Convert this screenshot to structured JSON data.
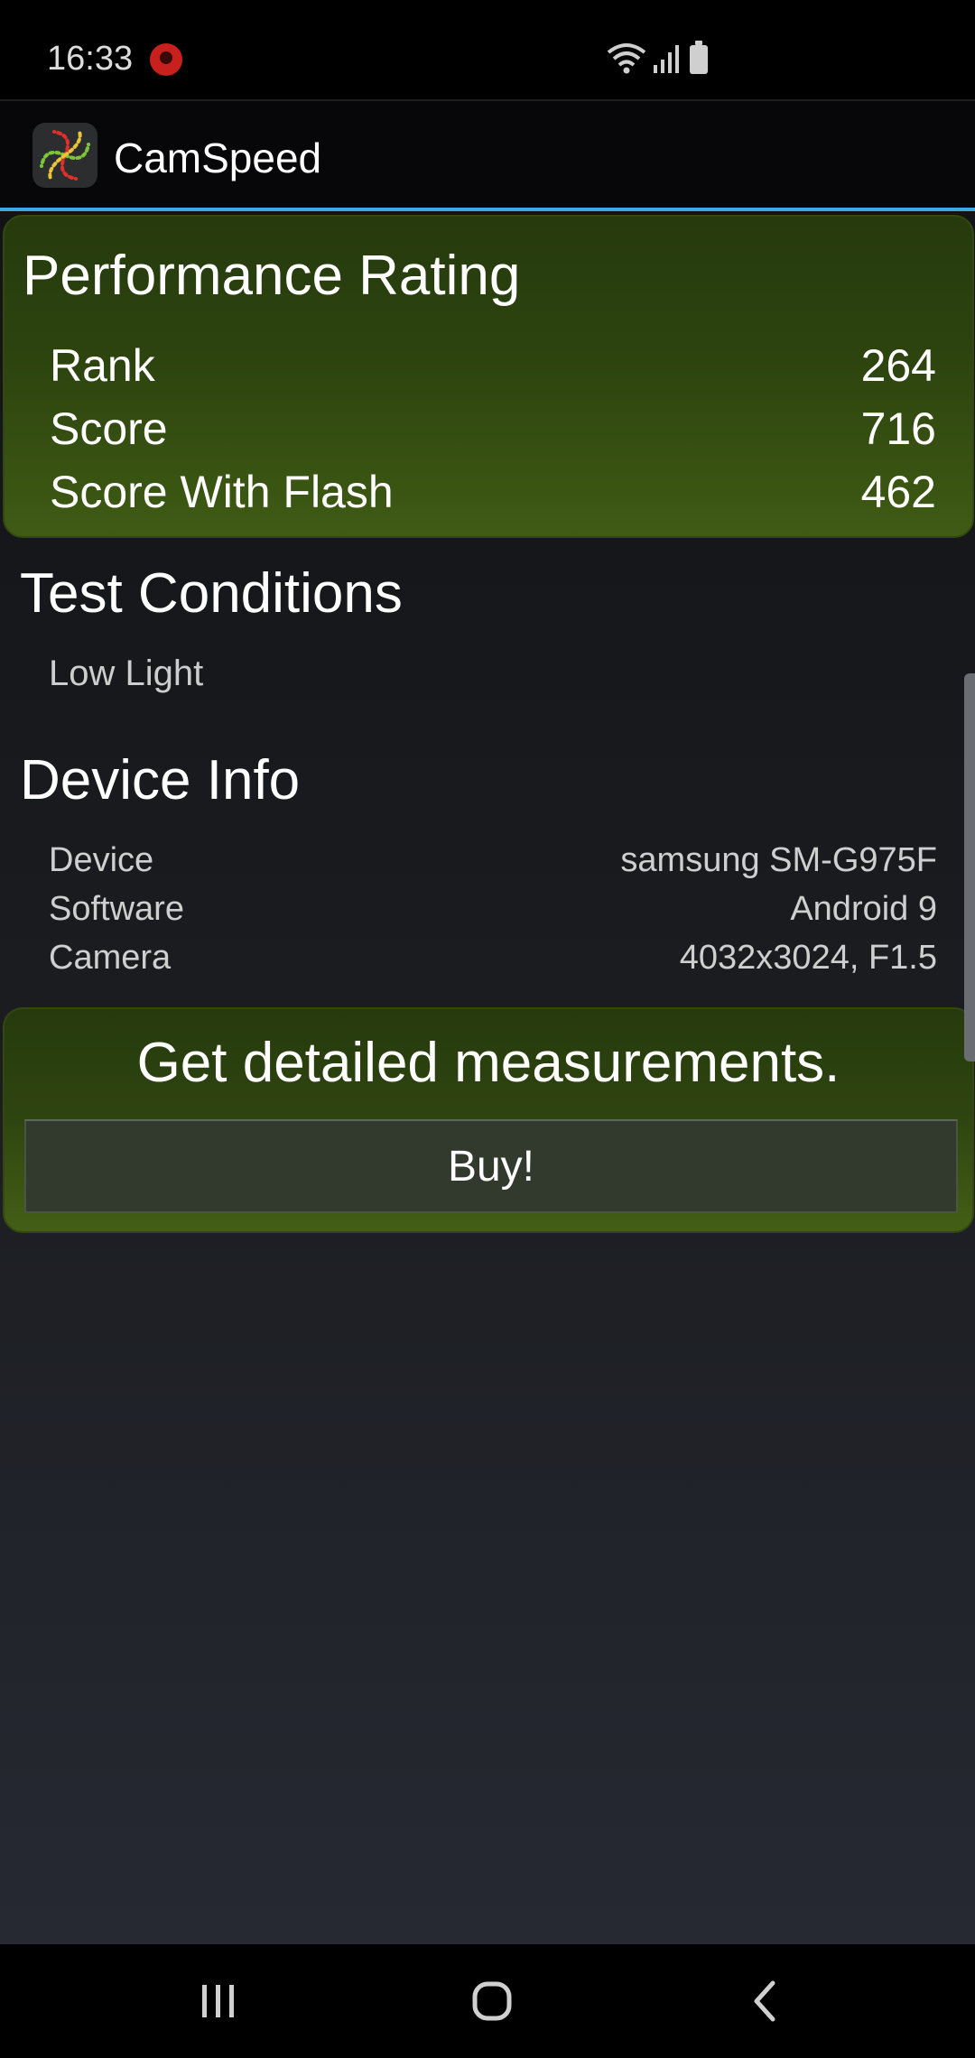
{
  "status_bar": {
    "time": "16:33"
  },
  "app_bar": {
    "title": "CamSpeed"
  },
  "performance": {
    "heading": "Performance Rating",
    "rows": [
      {
        "label": "Rank",
        "value": "264"
      },
      {
        "label": "Score",
        "value": "716"
      },
      {
        "label": "Score With Flash",
        "value": "462"
      }
    ]
  },
  "test_conditions": {
    "heading": "Test Conditions",
    "value": "Low Light"
  },
  "device_info": {
    "heading": "Device Info",
    "rows": [
      {
        "label": "Device",
        "value": "samsung SM-G975F"
      },
      {
        "label": "Software",
        "value": "Android 9"
      },
      {
        "label": "Camera",
        "value": "4032x3024, F1.5"
      }
    ]
  },
  "promo": {
    "heading": "Get detailed measurements.",
    "button_label": "Buy!"
  },
  "colors": {
    "accent": "#3ea9e0",
    "card_green": "#2d440f",
    "background": "#1b1d21"
  },
  "icons": [
    "notification-icon",
    "wifi-icon",
    "signal-icon",
    "battery-icon",
    "app-logo",
    "recents-icon",
    "home-icon",
    "back-icon"
  ]
}
